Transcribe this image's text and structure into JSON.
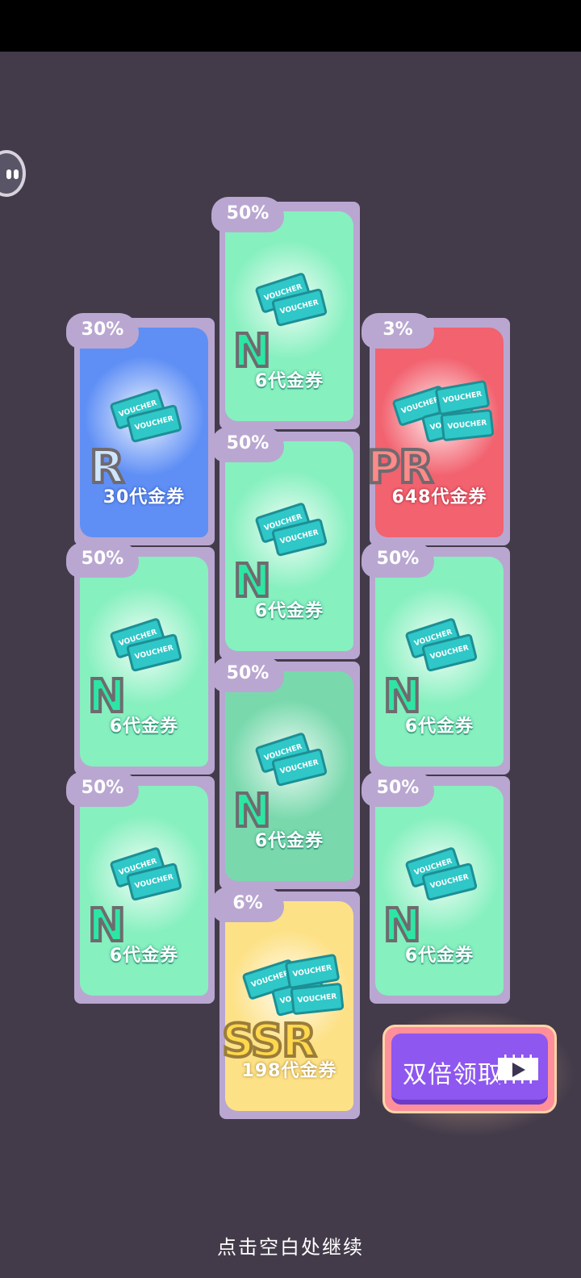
{
  "cards": [
    {
      "name": "card-n-top",
      "theme": "green",
      "probability": "50%",
      "rarity": "N",
      "prize": "6代金券",
      "icon": "voucher-pair-icon"
    },
    {
      "name": "card-r",
      "theme": "blue",
      "probability": "30%",
      "rarity": "R",
      "prize": "30代金券",
      "icon": "voucher-pair-icon"
    },
    {
      "name": "card-pr",
      "theme": "red",
      "probability": "3%",
      "rarity": "PR",
      "prize": "648代金券",
      "icon": "voucher-stack-icon"
    },
    {
      "name": "card-n-mid-center",
      "theme": "green",
      "probability": "50%",
      "rarity": "N",
      "prize": "6代金券",
      "icon": "voucher-pair-icon"
    },
    {
      "name": "card-n-mid-left",
      "theme": "green",
      "probability": "50%",
      "rarity": "N",
      "prize": "6代金券",
      "icon": "voucher-pair-icon"
    },
    {
      "name": "card-n-mid-right",
      "theme": "green",
      "probability": "50%",
      "rarity": "N",
      "prize": "6代金券",
      "icon": "voucher-pair-icon"
    },
    {
      "name": "card-n-lower-center",
      "theme": "dim",
      "probability": "50%",
      "rarity": "N",
      "prize": "6代金券",
      "icon": "voucher-pair-icon"
    },
    {
      "name": "card-n-bottom-left",
      "theme": "green",
      "probability": "50%",
      "rarity": "N",
      "prize": "6代金券",
      "icon": "voucher-pair-icon"
    },
    {
      "name": "card-n-bottom-right",
      "theme": "green",
      "probability": "50%",
      "rarity": "N",
      "prize": "6代金券",
      "icon": "voucher-pair-icon"
    },
    {
      "name": "card-ssr",
      "theme": "yellow",
      "probability": "6%",
      "rarity": "SSR",
      "prize": "198代金券",
      "icon": "voucher-stack-icon"
    }
  ],
  "voucher_text": "VOUCHER",
  "double_claim": {
    "label": "双倍领取",
    "icon": "video-play-icon"
  },
  "continue_hint": "点击空白处继续",
  "colors": {
    "background": "#433b4a",
    "card_frame": "#b9a7d1",
    "green": "#86f0bf",
    "blue": "#5f8ff5",
    "red": "#f2626f",
    "yellow": "#fde186",
    "button": "#8e57f0"
  }
}
